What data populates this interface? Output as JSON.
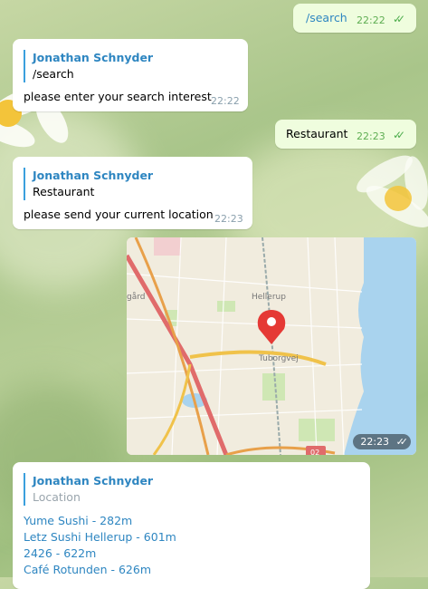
{
  "messages": {
    "m1": {
      "text": "/search",
      "time": "22:22"
    },
    "m2": {
      "reply_name": "Jonathan Schnyder",
      "reply_text": "/search",
      "text": "please enter your search interest",
      "time": "22:22"
    },
    "m3": {
      "text": "Restaurant",
      "time": "22:23"
    },
    "m4": {
      "reply_name": "Jonathan Schnyder",
      "reply_text": "Restaurant",
      "text": "please send your current location",
      "time": "22:23"
    },
    "m5": {
      "time": "22:23",
      "map_labels": {
        "district": "Hellerup",
        "road": "Tuborgvej",
        "left": "gård",
        "route": "02"
      }
    },
    "m6": {
      "reply_name": "Jonathan Schnyder",
      "reply_text": "Location",
      "links": [
        "Yume Sushi - 282m",
        "Letz Sushi Hellerup - 601m",
        "2426 - 622m",
        "Café Rotunden - 626m"
      ]
    }
  },
  "colors": {
    "accent": "#2e86c1",
    "outgoing": "#effdde",
    "check": "#4fae4e",
    "pin": "#e53935"
  },
  "icons": {
    "read_check": "double-check-icon",
    "pin": "map-pin-icon"
  }
}
